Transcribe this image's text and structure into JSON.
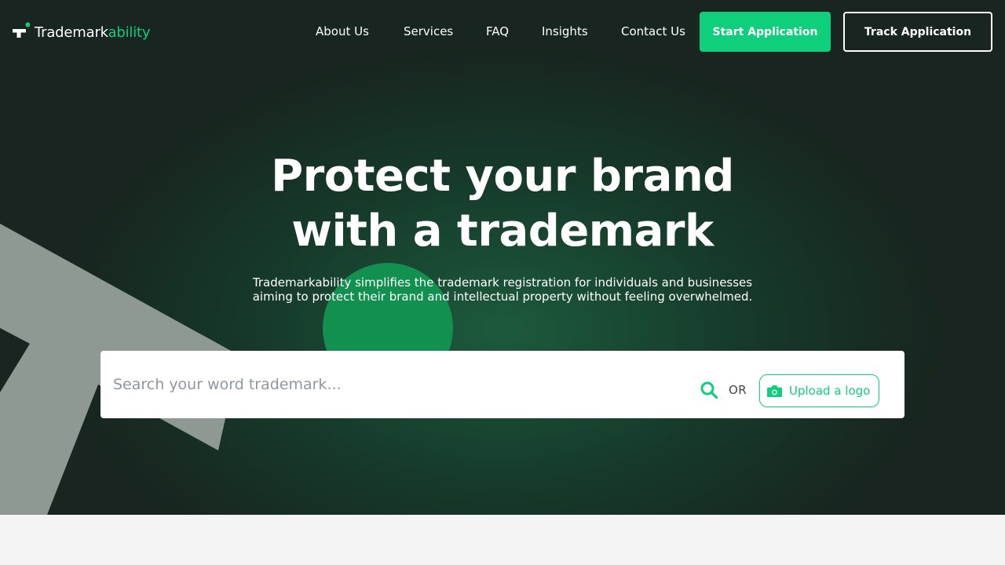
{
  "brand": {
    "name_part1": "Trademark",
    "name_part2": "ability",
    "accent_color": "#0fce7c",
    "logo_icon": "t-logo-icon"
  },
  "nav": {
    "items": [
      {
        "label": "About Us"
      },
      {
        "label": "Services"
      },
      {
        "label": "FAQ"
      },
      {
        "label": "Insights"
      },
      {
        "label": "Contact Us"
      }
    ],
    "start_label": "Start Application",
    "track_label": "Track Application"
  },
  "hero": {
    "title_line1": "Protect your brand",
    "title_line2": "with a trademark",
    "subtitle_line1": "Trademarkability simplifies the trademark registration for individuals and businesses",
    "subtitle_line2": "aiming to protect their brand and intellectual property without feeling overwhelmed."
  },
  "search": {
    "placeholder": "Search your word trademark...",
    "value": "",
    "search_icon": "search-icon",
    "or_label": "OR",
    "upload_label": "Upload a logo",
    "upload_icon": "camera-icon"
  },
  "colors": {
    "hero_bg": "#182520",
    "accent": "#0fce7c",
    "deco_grey": "#8e9994"
  }
}
